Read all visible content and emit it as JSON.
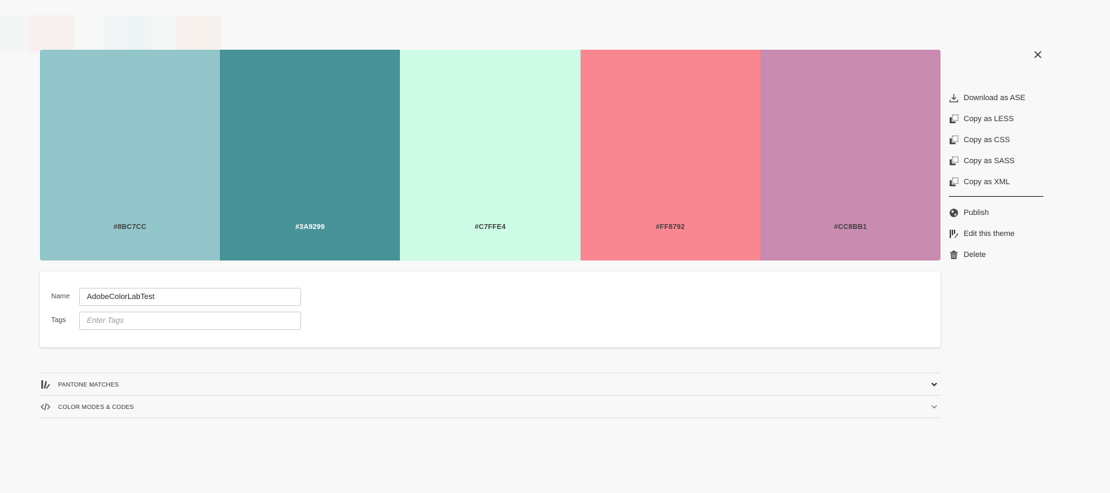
{
  "colors": {
    "page_bg": "#f8f8f8",
    "ghost_swatches": [
      "#f0f6f4",
      "#f8ebe8",
      "#f8f8f8",
      "#eef5f5",
      "#e8f2f2",
      "#f3f8f6",
      "#f8ece8"
    ]
  },
  "swatches": [
    {
      "hex": "#8BC7CC",
      "color": "#93c6cb",
      "text_tone": "dark"
    },
    {
      "hex": "#3A9299",
      "color": "#489298",
      "text_tone": "light"
    },
    {
      "hex": "#C7FFE4",
      "color": "#cdfbe5",
      "text_tone": "dark"
    },
    {
      "hex": "#FF8792",
      "color": "#f98791",
      "text_tone": "dark"
    },
    {
      "hex": "#CC8BB1",
      "color": "#c88cb0",
      "text_tone": "dark"
    }
  ],
  "details": {
    "name_label": "Name",
    "name_value": "AdobeColorLabTest",
    "tags_label": "Tags",
    "tags_placeholder": "Enter Tags"
  },
  "accordions": [
    {
      "label": "PANTONE MATCHES",
      "icon": "pantone-icon"
    },
    {
      "label": "COLOR MODES & CODES",
      "icon": "code-icon"
    }
  ],
  "actions": {
    "close_icon": "close-icon",
    "export": [
      {
        "label": "Download as ASE",
        "icon": "download-icon"
      },
      {
        "label": "Copy as LESS",
        "icon": "copy-icon"
      },
      {
        "label": "Copy as CSS",
        "icon": "copy-icon"
      },
      {
        "label": "Copy as SASS",
        "icon": "copy-icon"
      },
      {
        "label": "Copy as XML",
        "icon": "copy-icon"
      }
    ],
    "manage": [
      {
        "label": "Publish",
        "icon": "globe-icon"
      },
      {
        "label": "Edit this theme",
        "icon": "edit-palette-icon"
      },
      {
        "label": "Delete",
        "icon": "trash-icon"
      }
    ]
  }
}
